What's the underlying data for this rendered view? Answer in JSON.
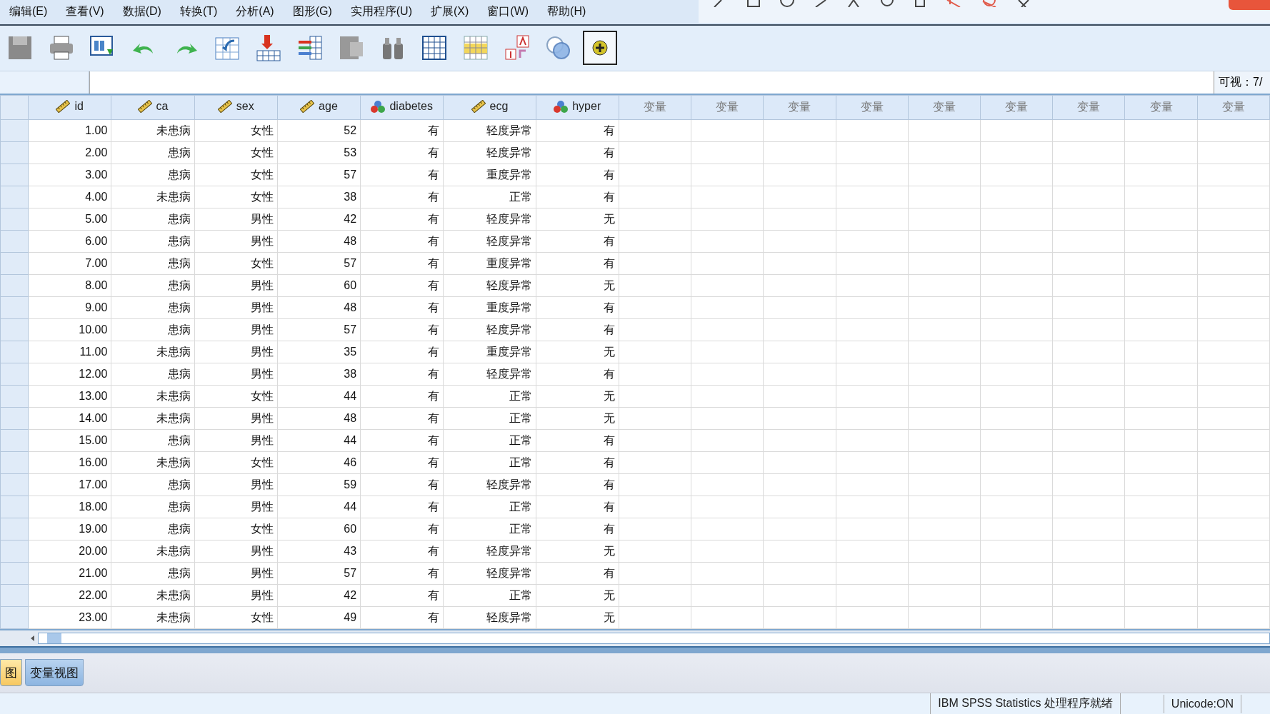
{
  "menu": [
    {
      "label": "编辑(E)"
    },
    {
      "label": "查看(V)"
    },
    {
      "label": "数据(D)"
    },
    {
      "label": "转换(T)"
    },
    {
      "label": "分析(A)"
    },
    {
      "label": "图形(G)"
    },
    {
      "label": "实用程序(U)"
    },
    {
      "label": "扩展(X)"
    },
    {
      "label": "窗口(W)"
    },
    {
      "label": "帮助(H)"
    }
  ],
  "visible_label": "可视：7/",
  "columns": [
    {
      "name": "id",
      "kind": "scale"
    },
    {
      "name": "ca",
      "kind": "scale"
    },
    {
      "name": "sex",
      "kind": "scale"
    },
    {
      "name": "age",
      "kind": "scale"
    },
    {
      "name": "diabetes",
      "kind": "nominal"
    },
    {
      "name": "ecg",
      "kind": "scale"
    },
    {
      "name": "hyper",
      "kind": "nominal"
    },
    {
      "name": "变量",
      "kind": "empty"
    },
    {
      "name": "变量",
      "kind": "empty"
    },
    {
      "name": "变量",
      "kind": "empty"
    },
    {
      "name": "变量",
      "kind": "empty"
    },
    {
      "name": "变量",
      "kind": "empty"
    },
    {
      "name": "变量",
      "kind": "empty"
    },
    {
      "name": "变量",
      "kind": "empty"
    },
    {
      "name": "变量",
      "kind": "empty"
    },
    {
      "name": "变量",
      "kind": "empty"
    }
  ],
  "rows": [
    [
      "1.00",
      "未患病",
      "女性",
      "52",
      "有",
      "轻度异常",
      "有"
    ],
    [
      "2.00",
      "患病",
      "女性",
      "53",
      "有",
      "轻度异常",
      "有"
    ],
    [
      "3.00",
      "患病",
      "女性",
      "57",
      "有",
      "重度异常",
      "有"
    ],
    [
      "4.00",
      "未患病",
      "女性",
      "38",
      "有",
      "正常",
      "有"
    ],
    [
      "5.00",
      "患病",
      "男性",
      "42",
      "有",
      "轻度异常",
      "无"
    ],
    [
      "6.00",
      "患病",
      "男性",
      "48",
      "有",
      "轻度异常",
      "有"
    ],
    [
      "7.00",
      "患病",
      "女性",
      "57",
      "有",
      "重度异常",
      "有"
    ],
    [
      "8.00",
      "患病",
      "男性",
      "60",
      "有",
      "轻度异常",
      "无"
    ],
    [
      "9.00",
      "患病",
      "男性",
      "48",
      "有",
      "重度异常",
      "有"
    ],
    [
      "10.00",
      "患病",
      "男性",
      "57",
      "有",
      "轻度异常",
      "有"
    ],
    [
      "11.00",
      "未患病",
      "男性",
      "35",
      "有",
      "重度异常",
      "无"
    ],
    [
      "12.00",
      "患病",
      "男性",
      "38",
      "有",
      "轻度异常",
      "有"
    ],
    [
      "13.00",
      "未患病",
      "女性",
      "44",
      "有",
      "正常",
      "无"
    ],
    [
      "14.00",
      "未患病",
      "男性",
      "48",
      "有",
      "正常",
      "无"
    ],
    [
      "15.00",
      "患病",
      "男性",
      "44",
      "有",
      "正常",
      "有"
    ],
    [
      "16.00",
      "未患病",
      "女性",
      "46",
      "有",
      "正常",
      "有"
    ],
    [
      "17.00",
      "患病",
      "男性",
      "59",
      "有",
      "轻度异常",
      "有"
    ],
    [
      "18.00",
      "患病",
      "男性",
      "44",
      "有",
      "正常",
      "有"
    ],
    [
      "19.00",
      "患病",
      "女性",
      "60",
      "有",
      "正常",
      "有"
    ],
    [
      "20.00",
      "未患病",
      "男性",
      "43",
      "有",
      "轻度异常",
      "无"
    ],
    [
      "21.00",
      "患病",
      "男性",
      "57",
      "有",
      "轻度异常",
      "有"
    ],
    [
      "22.00",
      "未患病",
      "男性",
      "42",
      "有",
      "正常",
      "无"
    ],
    [
      "23.00",
      "未患病",
      "女性",
      "49",
      "有",
      "轻度异常",
      "无"
    ]
  ],
  "tabs": [
    {
      "label": "图",
      "selected": true
    },
    {
      "label": "变量视图",
      "selected": false
    }
  ],
  "status": [
    "IBM SPSS Statistics 处理程序就绪",
    "Unicode:ON"
  ]
}
